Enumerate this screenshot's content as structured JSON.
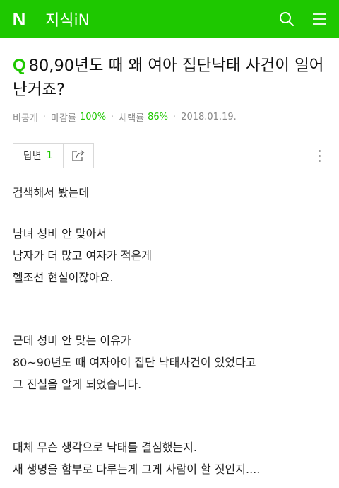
{
  "header": {
    "logo": "N",
    "service": "지식iN",
    "colors": {
      "brand": "#1ec800"
    },
    "icons": [
      "search-icon",
      "menu-icon"
    ]
  },
  "question": {
    "q_mark": "Q",
    "title": "80,90년도 때 왜 여아 집단낙태 사건이 일어난거죠?",
    "meta": {
      "author": "비공개",
      "deadline_label": "마감률",
      "deadline_value": "100%",
      "adopt_label": "채택률",
      "adopt_value": "86%",
      "date": "2018.01.19."
    }
  },
  "actions": {
    "answer_label": "답변",
    "answer_count": "1",
    "icons": [
      "share-icon",
      "more-vertical-icon"
    ]
  },
  "body": {
    "paragraphs": [
      [
        "검색해서 봤는데"
      ],
      [
        "남녀 성비 안 맞아서",
        "남자가 더 많고 여자가 적은게",
        "헬조선 현실이잖아요."
      ],
      [
        "근데 성비 안 맞는 이유가",
        "80~90년도 때 여자아이 집단 낙태사건이 있었다고",
        "그 진실을 알게 되었습니다."
      ],
      [
        "대체 무슨 생각으로 낙태를 결심했는지.",
        "새 생명을 함부로 다루는게 그게 사람이 할 짓인지...."
      ]
    ]
  }
}
